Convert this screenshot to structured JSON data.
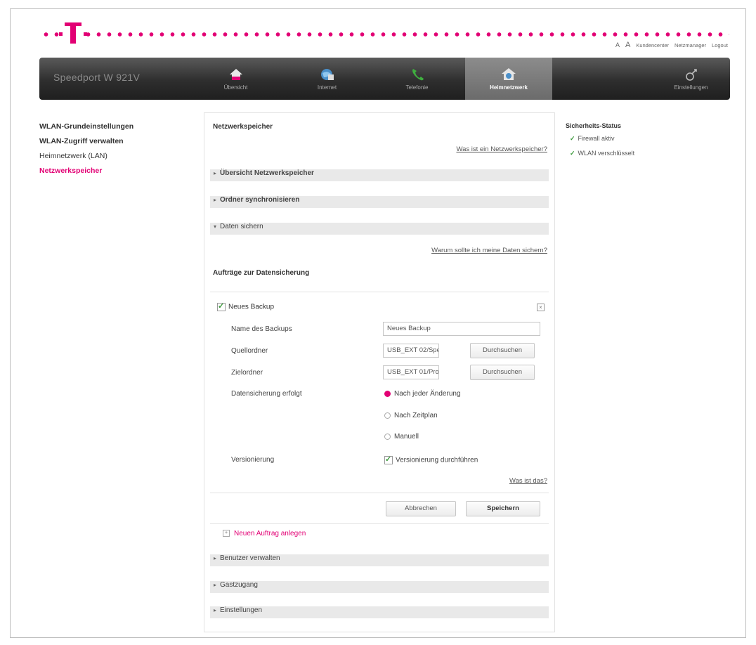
{
  "header": {
    "font_small": "A",
    "font_large": "A",
    "links": [
      "Kundencenter",
      "Netzmanager",
      "Logout"
    ]
  },
  "nav": {
    "brand": "Speedport W 921V",
    "items": [
      {
        "label": "Übersicht",
        "icon": "home-icon"
      },
      {
        "label": "Internet",
        "icon": "globe-icon"
      },
      {
        "label": "Telefonie",
        "icon": "phone-icon"
      },
      {
        "label": "Heimnetzwerk",
        "icon": "network-home-icon",
        "active": true
      },
      {
        "label": "Einstellungen",
        "icon": "settings-icon"
      }
    ]
  },
  "sidebar": {
    "items": [
      {
        "label": "WLAN-Grundeinstellungen"
      },
      {
        "label": "WLAN-Zugriff verwalten"
      },
      {
        "label": "Heimnetzwerk (LAN)"
      },
      {
        "label": "Netzwerkspeicher",
        "active": true
      }
    ]
  },
  "main": {
    "title": "Netzwerkspeicher",
    "help_link": "Was ist ein Netzwerkspeicher?",
    "sections": [
      "Übersicht Netzwerkspeicher",
      "Ordner synchronisieren",
      "Daten sichern",
      "Benutzer verwalten",
      "Gastzugang",
      "Einstellungen"
    ],
    "why_link": "Warum sollte ich meine Daten sichern?",
    "jobs_heading": "Aufträge zur Datensicherung",
    "backup": {
      "title": "Neues Backup",
      "name_label": "Name des Backups",
      "name_value": "Neues Backup",
      "source_label": "Quellordner",
      "source_value": "USB_EXT 02/Spe",
      "target_label": "Zielordner",
      "target_value": "USB_EXT 01/Pro",
      "browse_label": "Durchsuchen",
      "mode_label": "Datensicherung erfolgt",
      "modes": [
        "Nach jeder Änderung",
        "Nach Zeitplan",
        "Manuell"
      ],
      "selected_mode": "Nach jeder Änderung",
      "versioning_label": "Versionierung",
      "versioning_option": "Versionierung durchführen",
      "versioning_checked": true,
      "what_link": "Was ist das?",
      "cancel_label": "Abbrechen",
      "save_label": "Speichern"
    },
    "new_job": "Neuen Auftrag anlegen"
  },
  "status": {
    "title": "Sicherheits-Status",
    "items": [
      "Firewall aktiv",
      "WLAN verschlüsselt"
    ]
  },
  "colors": {
    "brand_magenta": "#e20074",
    "ok_green": "#3c9a3c"
  }
}
